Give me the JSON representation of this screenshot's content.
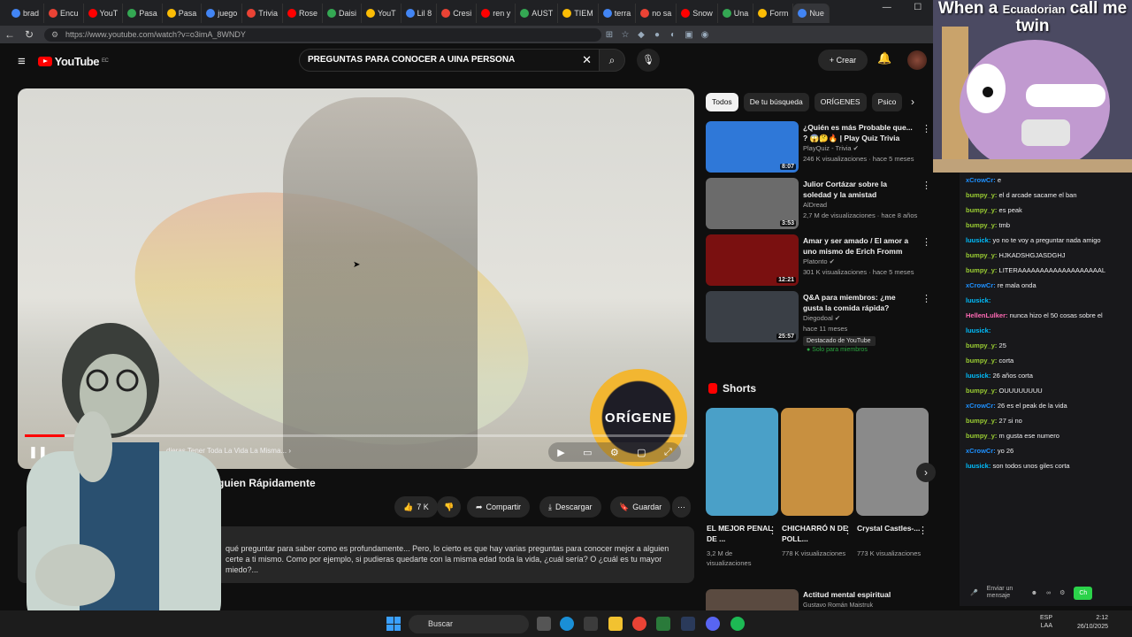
{
  "browser": {
    "tabs": [
      "brad",
      "Encu",
      "YouT",
      "Pasa",
      "Pasa",
      "juego",
      "Trivia",
      "Rose",
      "Daisi",
      "YouT",
      "Lil 8",
      "Cresi",
      "ren y",
      "AUST",
      "TIEM",
      "terra",
      "no sa",
      "Snow",
      "Una",
      "Form",
      "Nue"
    ],
    "url": "https://www.youtube.com/watch?v=o3imA_8WNDY"
  },
  "yt": {
    "logo": "YouTube",
    "country": "EC",
    "search_value": "PREGUNTAS PARA CONOCER A UINA PERSONA",
    "create_label": "Crear",
    "video_title": "Alguien Rápidamente",
    "chapter": "dieras Tener Toda La Vida La Misma...",
    "progress": 0.06,
    "watermark": "ORÍGENE",
    "likes": "7 K",
    "share": "Compartir",
    "download": "Descargar",
    "save": "Guardar",
    "desc1": "qué preguntar para saber como es profundamente... Pero, lo cierto es que hay varias preguntas para conocer mejor a alguien",
    "desc2": "certe a ti mismo. Como por ejemplo, si pudieras quedarte con la misma edad toda la vida, ¿cuál sería? O ¿cuál es tu mayor miedo?...",
    "chips": [
      "Todos",
      "De tu búsqueda",
      "ORÍGENES",
      "Psico"
    ],
    "recs": [
      {
        "title": "¿Quién es más Probable que... ? 😱🤔🔥 | Play Quiz Trivia",
        "channel": "PlayQuiz - Trivia ✔",
        "meta": "246 K visualizaciones · hace 5 meses",
        "dur": "8:07",
        "color": "#2f78d8"
      },
      {
        "title": "Julior Cortázar sobre la soledad y la amistad",
        "channel": "AlDread",
        "meta": "2,7 M de visualizaciones · hace 8 años",
        "dur": "3:53",
        "color": "#6b6b6b"
      },
      {
        "title": "Amar y ser amado / El amor a uno mismo de Erich Fromm",
        "channel": "Platonto ✔",
        "meta": "301 K visualizaciones · hace 5 meses",
        "dur": "12:21",
        "color": "#7a1010"
      },
      {
        "title": "Q&A para miembros: ¿me gusta la comida rápida?",
        "channel": "Diegodoal ✔",
        "meta": "hace 11 meses",
        "dur": "25:57",
        "color": "#3a3f46"
      }
    ],
    "rec_badge": "Destacado de YouTube",
    "rec_members": "Solo para miembros",
    "shorts_label": "Shorts",
    "shorts": [
      {
        "title": "EL MEJOR PENAL DE ...",
        "views": "3,2 M de visualizaciones",
        "color": "#4aa0c8"
      },
      {
        "title": "CHICHARRÓ N DE POLL...",
        "views": "778 K visualizaciones",
        "color": "#c89040"
      },
      {
        "title": "Crystal Castles-...",
        "views": "773 K visualizaciones",
        "color": "#8a8a8a"
      }
    ],
    "next_rec": {
      "title": "Actitud mental espiritual",
      "channel": "Gustavo Román Maistruk"
    }
  },
  "stream": {
    "meme_line1": "When a",
    "meme_small": "Ecuadorian",
    "meme_line1b": "call me",
    "meme_line2": "twin",
    "chat": [
      {
        "user": "xCrowCr:",
        "msg": "e",
        "color": "#1e90ff"
      },
      {
        "user": "bumpy_y:",
        "msg": "el d arcade sacame el ban",
        "color": "#9acd32"
      },
      {
        "user": "bumpy_y:",
        "msg": "es peak",
        "color": "#9acd32"
      },
      {
        "user": "bumpy_y:",
        "msg": "tmb",
        "color": "#9acd32"
      },
      {
        "user": "luusick:",
        "msg": "yo no te voy a preguntar nada amigo",
        "color": "#00bfff"
      },
      {
        "user": "bumpy_y:",
        "msg": "HJKADSHGJASDGHJ",
        "color": "#9acd32"
      },
      {
        "user": "bumpy_y:",
        "msg": "LITERAAAAAAAAAAAAAAAAAAAL",
        "color": "#9acd32"
      },
      {
        "user": "xCrowCr:",
        "msg": "re mala onda",
        "color": "#1e90ff"
      },
      {
        "user": "luusick:",
        "msg": "",
        "color": "#00bfff"
      },
      {
        "user": "HellenLulker:",
        "msg": "nunca hizo el 50 cosas sobre el",
        "color": "#ff69b4"
      },
      {
        "user": "luusick:",
        "msg": "",
        "color": "#00bfff"
      },
      {
        "user": "bumpy_y:",
        "msg": "25",
        "color": "#9acd32"
      },
      {
        "user": "bumpy_y:",
        "msg": "corta",
        "color": "#9acd32"
      },
      {
        "user": "luusick:",
        "msg": "26 años corta",
        "color": "#00bfff"
      },
      {
        "user": "bumpy_y:",
        "msg": "OUUUUUUUU",
        "color": "#9acd32"
      },
      {
        "user": "xCrowCr:",
        "msg": "26 es el peak de la vida",
        "color": "#1e90ff"
      },
      {
        "user": "bumpy_y:",
        "msg": "27 si no",
        "color": "#9acd32"
      },
      {
        "user": "bumpy_y:",
        "msg": "m gusta ese numero",
        "color": "#9acd32"
      },
      {
        "user": "xCrowCr:",
        "msg": "yo 26",
        "color": "#1e90ff"
      },
      {
        "user": "luusick:",
        "msg": "son todos unos giles corta",
        "color": "#00bfff"
      }
    ],
    "send_label": "Enviar un mensaje"
  },
  "taskbar": {
    "search": "Buscar",
    "lang1": "ESP",
    "lang2": "LAA",
    "time": "2:12",
    "date": "26/10/2025"
  }
}
